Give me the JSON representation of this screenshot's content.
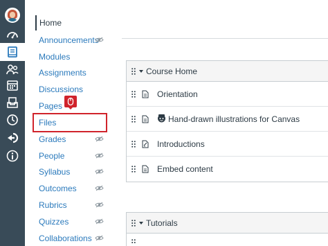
{
  "course_nav": {
    "items": [
      {
        "label": "Home",
        "active": true,
        "hidden_icon": false
      },
      {
        "label": "Announcements",
        "active": false,
        "hidden_icon": true
      },
      {
        "label": "Modules",
        "active": false,
        "hidden_icon": false
      },
      {
        "label": "Assignments",
        "active": false,
        "hidden_icon": false
      },
      {
        "label": "Discussions",
        "active": false,
        "hidden_icon": false
      },
      {
        "label": "Pages",
        "active": false,
        "hidden_icon": false
      },
      {
        "label": "Files",
        "active": false,
        "hidden_icon": false,
        "highlighted": true
      },
      {
        "label": "Grades",
        "active": false,
        "hidden_icon": true
      },
      {
        "label": "People",
        "active": false,
        "hidden_icon": true
      },
      {
        "label": "Syllabus",
        "active": false,
        "hidden_icon": true
      },
      {
        "label": "Outcomes",
        "active": false,
        "hidden_icon": true
      },
      {
        "label": "Rubrics",
        "active": false,
        "hidden_icon": true
      },
      {
        "label": "Quizzes",
        "active": false,
        "hidden_icon": true
      },
      {
        "label": "Collaborations",
        "active": false,
        "hidden_icon": true
      }
    ]
  },
  "global_nav": {
    "icons": [
      "account-avatar",
      "dashboard-icon",
      "courses-icon",
      "groups-icon",
      "calendar-icon",
      "inbox-icon",
      "history-icon",
      "commons-icon",
      "help-icon"
    ],
    "active": "courses-icon"
  },
  "modules": [
    {
      "title": "Course Home",
      "items": [
        {
          "title": "Orientation",
          "icon": "page-icon",
          "emoji": false
        },
        {
          "title": "Hand-drawn illustrations for Canvas",
          "icon": "page-icon",
          "emoji": true
        },
        {
          "title": "Introductions",
          "icon": "discussion-icon",
          "emoji": false
        },
        {
          "title": "Embed content",
          "icon": "page-icon",
          "emoji": false
        }
      ]
    },
    {
      "title": "Tutorials",
      "items": []
    }
  ],
  "colors": {
    "rail": "#394b58",
    "link": "#2b7abc",
    "highlight": "#d0232b",
    "text": "#2d3b45"
  }
}
